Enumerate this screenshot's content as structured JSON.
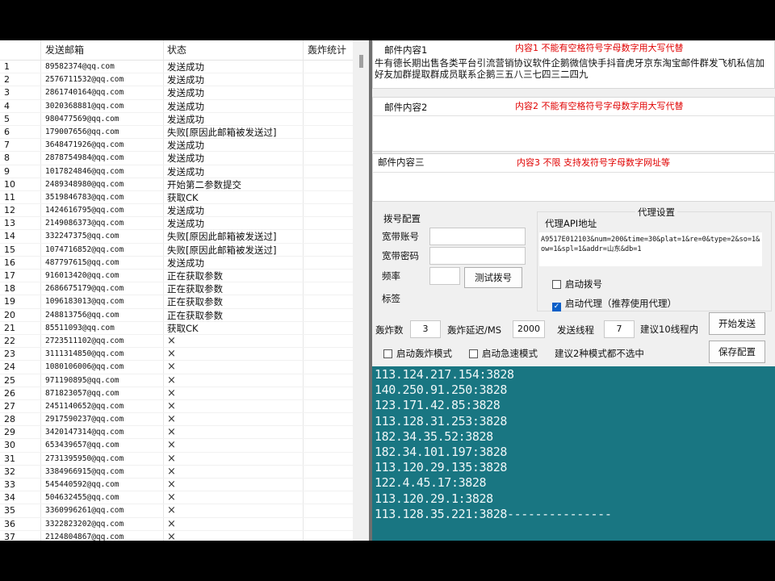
{
  "table": {
    "headers": [
      "发送邮箱",
      "状态",
      "轰炸统计"
    ],
    "rows": [
      {
        "n": "1",
        "email": "89582374@qq.com",
        "status": "发送成功"
      },
      {
        "n": "2",
        "email": "2576711532@qq.com",
        "status": "发送成功"
      },
      {
        "n": "3",
        "email": "2861740164@qq.com",
        "status": "发送成功"
      },
      {
        "n": "4",
        "email": "3020368881@qq.com",
        "status": "发送成功"
      },
      {
        "n": "5",
        "email": "980477569@qq.com",
        "status": "发送成功"
      },
      {
        "n": "6",
        "email": "179007656@qq.com",
        "status": "失败[原因此邮箱被发送过]"
      },
      {
        "n": "7",
        "email": "3648471926@qq.com",
        "status": "发送成功"
      },
      {
        "n": "8",
        "email": "2878754984@qq.com",
        "status": "发送成功"
      },
      {
        "n": "9",
        "email": "1017824846@qq.com",
        "status": "发送成功"
      },
      {
        "n": "10",
        "email": "2489348980@qq.com",
        "status": "开始第二参数提交"
      },
      {
        "n": "11",
        "email": "3519846783@qq.com",
        "status": "获取CK"
      },
      {
        "n": "12",
        "email": "1424616795@qq.com",
        "status": "发送成功"
      },
      {
        "n": "13",
        "email": "2149086373@qq.com",
        "status": "发送成功"
      },
      {
        "n": "14",
        "email": "332247375@qq.com",
        "status": "失败[原因此邮箱被发送过]"
      },
      {
        "n": "15",
        "email": "1074716852@qq.com",
        "status": "失败[原因此邮箱被发送过]"
      },
      {
        "n": "16",
        "email": "487797615@qq.com",
        "status": "发送成功"
      },
      {
        "n": "17",
        "email": "916013420@qq.com",
        "status": "正在获取参数"
      },
      {
        "n": "18",
        "email": "2686675179@qq.com",
        "status": "正在获取参数"
      },
      {
        "n": "19",
        "email": "1096183013@qq.com",
        "status": "正在获取参数"
      },
      {
        "n": "20",
        "email": "248813756@qq.com",
        "status": "正在获取参数"
      },
      {
        "n": "21",
        "email": "85511093@qq.com",
        "status": "获取CK"
      },
      {
        "n": "22",
        "email": "2723511102@qq.com",
        "status": "×"
      },
      {
        "n": "23",
        "email": "3111314850@qq.com",
        "status": "×"
      },
      {
        "n": "24",
        "email": "1080106006@qq.com",
        "status": "×"
      },
      {
        "n": "25",
        "email": "971190895@qq.com",
        "status": "×"
      },
      {
        "n": "26",
        "email": "871823057@qq.com",
        "status": "×"
      },
      {
        "n": "27",
        "email": "2451140652@qq.com",
        "status": "×"
      },
      {
        "n": "28",
        "email": "2917590237@qq.com",
        "status": "×"
      },
      {
        "n": "29",
        "email": "3420147314@qq.com",
        "status": "×"
      },
      {
        "n": "30",
        "email": "653439657@qq.com",
        "status": "×"
      },
      {
        "n": "31",
        "email": "2731395950@qq.com",
        "status": "×"
      },
      {
        "n": "32",
        "email": "3384966915@qq.com",
        "status": "×"
      },
      {
        "n": "33",
        "email": "545440592@qq.com",
        "status": "×"
      },
      {
        "n": "34",
        "email": "504632455@qq.com",
        "status": "×"
      },
      {
        "n": "35",
        "email": "3360996261@qq.com",
        "status": "×"
      },
      {
        "n": "36",
        "email": "3322823202@qq.com",
        "status": "×"
      },
      {
        "n": "37",
        "email": "2124804867@qq.com",
        "status": "×"
      }
    ]
  },
  "mail": {
    "content1_label": "邮件内容1",
    "content1_warn": "内容1 不能有空格符号字母数字用大写代替",
    "content1_text": "牛有德长期出售各类平台引流营销协议软件企鹅微信快手抖音虎牙京东淘宝邮件群发飞机私信加好友加群提取群成员联系企鹅三五八三七四三二四九",
    "content2_label": "邮件内容2",
    "content2_warn": "内容2 不能有空格符号字母数字用大写代替",
    "content3_label": "邮件内容三",
    "content3_warn": "内容3 不限 支持发符号字母数字网址等"
  },
  "dial": {
    "title": "拨号配置",
    "account_label": "宽带账号",
    "account_value": "",
    "password_label": "宽带密码",
    "password_value": "",
    "freq_label": "频率",
    "freq_value": "",
    "tag_label": "标签",
    "test_button": "测试拨号"
  },
  "proxy": {
    "title": "代理设置",
    "api_label": "代理API地址",
    "api_value": "A9517E012103&num=200&time=30&plat=1&re=0&type=2&so=1&ow=1&spl=1&addr=山东&db=1",
    "dial_checkbox": "启动拨号",
    "dial_checked": false,
    "proxy_checkbox": "启动代理（推荐使用代理）",
    "proxy_checked": true
  },
  "settings": {
    "bomb_count_label": "轰炸数",
    "bomb_count_value": "3",
    "delay_label": "轰炸延迟/MS",
    "delay_value": "2000",
    "threads_label": "发送线程",
    "threads_value": "7",
    "threads_hint": "建议10线程内",
    "start_button": "开始发送",
    "bomb_mode": "启动轰炸模式",
    "bomb_mode_checked": false,
    "speed_mode": "启动急速模式",
    "speed_mode_checked": false,
    "mode_hint": "建议2种模式都不选中",
    "save_button": "保存配置"
  },
  "console": {
    "lines": [
      "113.124.217.154:3828",
      "140.250.91.250:3828",
      "123.171.42.85:3828",
      "113.128.31.253:3828",
      "182.34.35.52:3828",
      "182.34.101.197:3828",
      "113.120.29.135:3828",
      "122.4.45.17:3828",
      "113.120.29.1:3828",
      "113.128.35.221:3828---------------"
    ]
  }
}
